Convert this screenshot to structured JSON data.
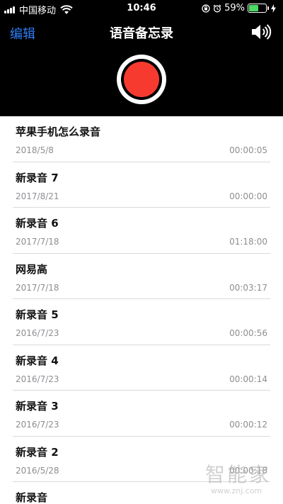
{
  "status_bar": {
    "carrier": "中国移动",
    "time": "10:46",
    "battery_percent_text": "59%",
    "battery_level": 0.59,
    "battery_color": "#4cd964"
  },
  "nav": {
    "edit_label": "编辑",
    "title": "语音备忘录",
    "speaker_icon": "speaker-volume-icon"
  },
  "record": {
    "button_color": "#f63a30"
  },
  "recordings": [
    {
      "title": "苹果手机怎么录音",
      "date": "2018/5/8",
      "duration": "00:00:05"
    },
    {
      "title": "新录音 7",
      "date": "2017/8/21",
      "duration": "00:00:00"
    },
    {
      "title": "新录音 6",
      "date": "2017/7/18",
      "duration": "01:18:00"
    },
    {
      "title": "网易高",
      "date": "2017/7/18",
      "duration": "00:03:17"
    },
    {
      "title": "新录音 5",
      "date": "2016/7/23",
      "duration": "00:00:56"
    },
    {
      "title": "新录音 4",
      "date": "2016/7/23",
      "duration": "00:00:14"
    },
    {
      "title": "新录音 3",
      "date": "2016/7/23",
      "duration": "00:00:12"
    },
    {
      "title": "新录音 2",
      "date": "2016/5/28",
      "duration": "00:00:18"
    },
    {
      "title": "新录音",
      "date": "",
      "duration": ""
    }
  ],
  "watermark": {
    "brand": "智能家",
    "url": "www.znj.com"
  }
}
